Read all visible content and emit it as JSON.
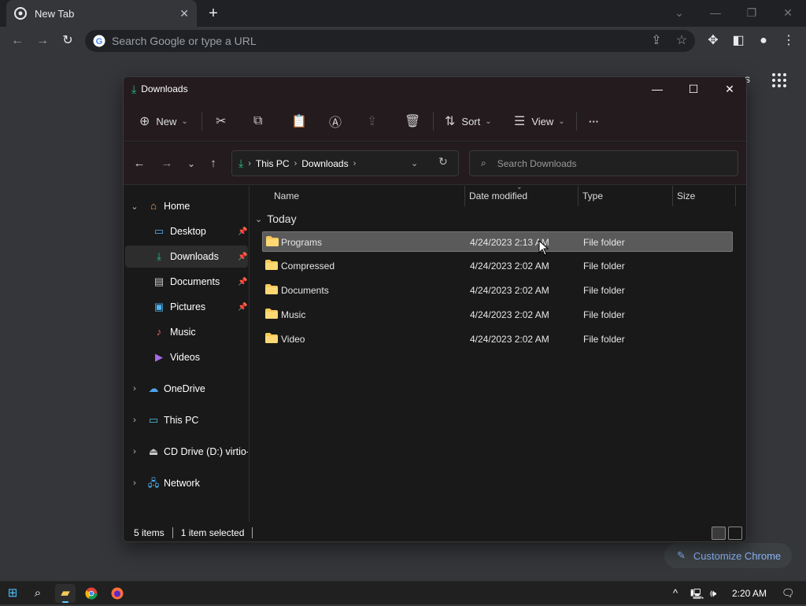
{
  "chrome": {
    "tab_title": "New Tab",
    "omnibox_placeholder": "Search Google or type a URL",
    "ntp_partial_text": "s",
    "customize_label": "Customize Chrome"
  },
  "explorer": {
    "title": "Downloads",
    "commands": {
      "new": "New",
      "sort": "Sort",
      "view": "View",
      "more": "···"
    },
    "breadcrumb": [
      "This PC",
      "Downloads"
    ],
    "search_placeholder": "Search Downloads",
    "sidebar": [
      {
        "label": "Home",
        "icon": "home-icon",
        "expandable": true,
        "expanded": true
      },
      {
        "label": "Desktop",
        "icon": "desktop-icon",
        "pinned": true
      },
      {
        "label": "Downloads",
        "icon": "downloads-icon",
        "pinned": true,
        "selected": true
      },
      {
        "label": "Documents",
        "icon": "documents-icon",
        "pinned": true
      },
      {
        "label": "Pictures",
        "icon": "pictures-icon",
        "pinned": true
      },
      {
        "label": "Music",
        "icon": "music-icon"
      },
      {
        "label": "Videos",
        "icon": "videos-icon"
      },
      {
        "label": "OneDrive",
        "icon": "onedrive-icon",
        "expandable": true
      },
      {
        "label": "This PC",
        "icon": "this-pc-icon",
        "expandable": true
      },
      {
        "label": "CD Drive (D:) virtio-v",
        "icon": "cd-drive-icon",
        "expandable": true
      },
      {
        "label": "Network",
        "icon": "network-icon",
        "expandable": true
      }
    ],
    "columns": [
      "Name",
      "Date modified",
      "Type",
      "Size"
    ],
    "group_label": "Today",
    "files": [
      {
        "name": "Programs",
        "date": "4/24/2023 2:13 AM",
        "type": "File folder",
        "selected": true
      },
      {
        "name": "Compressed",
        "date": "4/24/2023 2:02 AM",
        "type": "File folder"
      },
      {
        "name": "Documents",
        "date": "4/24/2023 2:02 AM",
        "type": "File folder"
      },
      {
        "name": "Music",
        "date": "4/24/2023 2:02 AM",
        "type": "File folder"
      },
      {
        "name": "Video",
        "date": "4/24/2023 2:02 AM",
        "type": "File folder"
      }
    ],
    "status": {
      "item_count": "5 items",
      "selection": "1 item selected"
    }
  },
  "taskbar": {
    "clock": "2:20 AM",
    "apps": [
      "start-icon",
      "search-icon",
      "file-explorer-icon",
      "chrome-icon",
      "firefox-icon"
    ]
  },
  "colors": {
    "accent_green": "#26c281",
    "folder_yellow": "#f8c95a",
    "chrome_link": "#8ab4f8"
  }
}
